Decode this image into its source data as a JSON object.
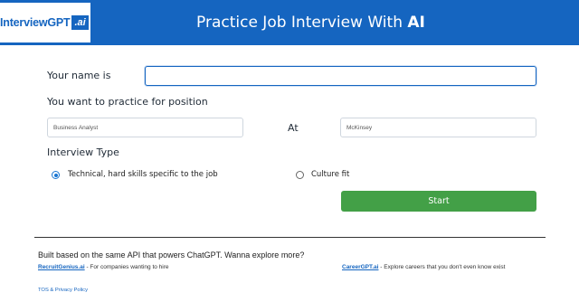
{
  "header": {
    "logo_text": "InterviewGPT",
    "logo_badge": ".ai",
    "title_prefix": "Practice Job Interview With ",
    "title_bold": "AI"
  },
  "form": {
    "name_label": "Your name is",
    "name_value": "",
    "position_label": "You want to practice for position",
    "position_value": "Business Analyst",
    "at_label": "At",
    "company_value": "McKinsey",
    "interview_type_label": "Interview Type",
    "options": [
      {
        "label": "Technical, hard skills specific to the job",
        "checked": true
      },
      {
        "label": "Culture fit",
        "checked": false
      }
    ],
    "start_label": "Start"
  },
  "footer": {
    "built_text": "Built based on the same API that powers ChatGPT. Wanna explore more?",
    "link1_name": "RecruitGenius.ai",
    "link1_desc": " - For companies wanting to hire",
    "link2_name": "CareerGPT.ai",
    "link2_desc": " - Explore careers that you don't even know exist",
    "tos": "TOS & Privacy Policy"
  },
  "colors": {
    "brand_blue": "#1565c0",
    "start_green": "#43a047"
  }
}
